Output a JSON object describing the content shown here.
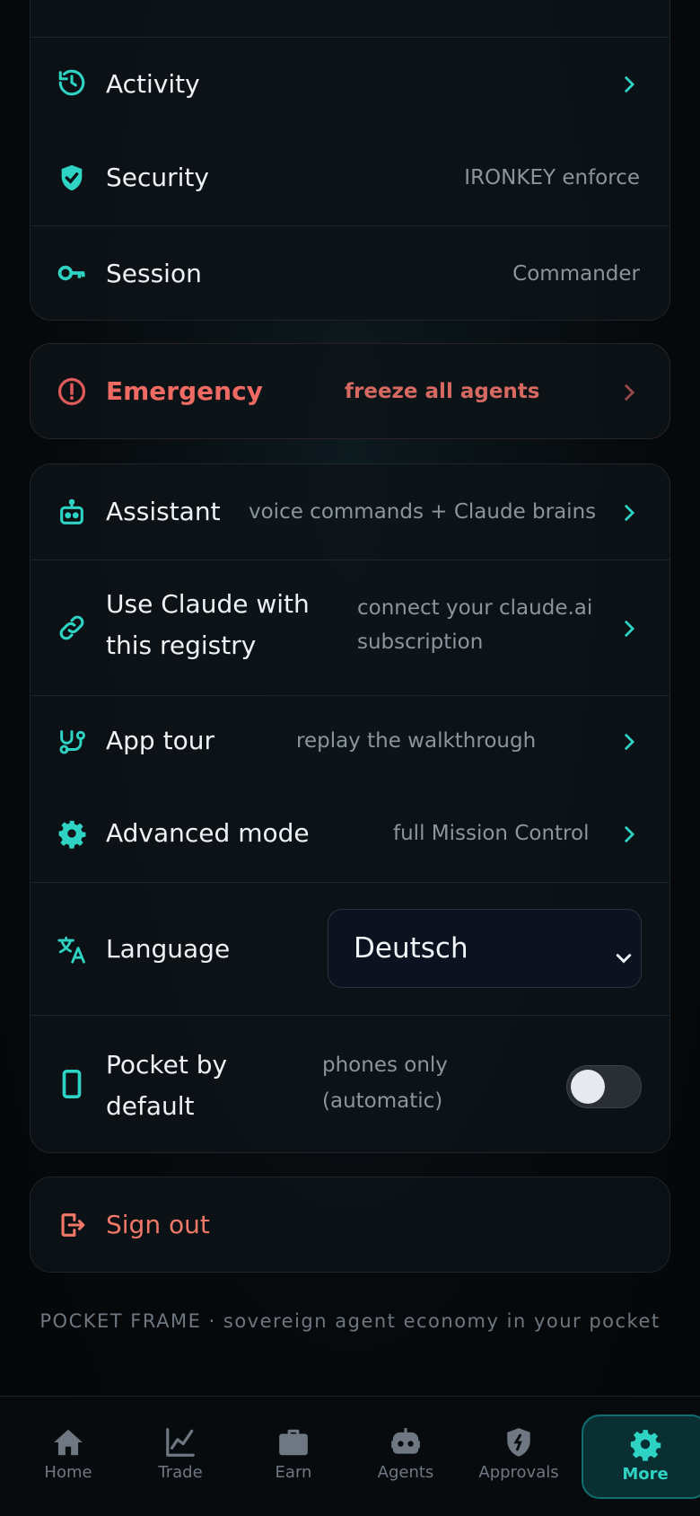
{
  "account_card": {
    "activity": {
      "label": "Activity",
      "icon": "history-icon"
    },
    "security": {
      "label": "Security",
      "value": "IRONKEY enforce",
      "icon": "shield-check-icon"
    },
    "session": {
      "label": "Session",
      "value": "Commander",
      "icon": "key-icon"
    }
  },
  "emergency": {
    "label": "Emergency",
    "value": "freeze all agents",
    "icon": "alert-circle-icon"
  },
  "tools_card": {
    "assistant": {
      "label": "Assistant",
      "value": "voice commands + Claude brains",
      "icon": "robot-icon"
    },
    "claude": {
      "label_line1": "Use Claude with",
      "label_line2": "this registry",
      "value_line1": "connect your claude.ai",
      "value_line2": "subscription",
      "icon": "link-icon"
    },
    "tour": {
      "label": "App tour",
      "value": "replay the walkthrough",
      "icon": "route-icon"
    },
    "advanced": {
      "label": "Advanced mode",
      "value": "full Mission Control",
      "icon": "gear-icon"
    },
    "language": {
      "label": "Language",
      "selected": "Deutsch",
      "icon": "translate-icon"
    },
    "pocket": {
      "label_line1": "Pocket by",
      "label_line2": "default",
      "value_line1": "phones only",
      "value_line2": "(automatic)",
      "toggle_on": false,
      "icon": "phone-icon"
    }
  },
  "signout": {
    "label": "Sign out",
    "icon": "logout-icon"
  },
  "footer": "POCKET FRAME · sovereign agent economy in your pocket",
  "tabs": [
    {
      "label": "Home",
      "icon": "home-icon"
    },
    {
      "label": "Trade",
      "icon": "chart-line-icon"
    },
    {
      "label": "Earn",
      "icon": "briefcase-icon"
    },
    {
      "label": "Agents",
      "icon": "robot-icon"
    },
    {
      "label": "Approvals",
      "icon": "shield-icon"
    },
    {
      "label": "More",
      "icon": "gear-icon",
      "active": true
    }
  ],
  "colors": {
    "accent": "#2ed3c4",
    "danger": "#e05a5a",
    "signout": "#f07868"
  }
}
